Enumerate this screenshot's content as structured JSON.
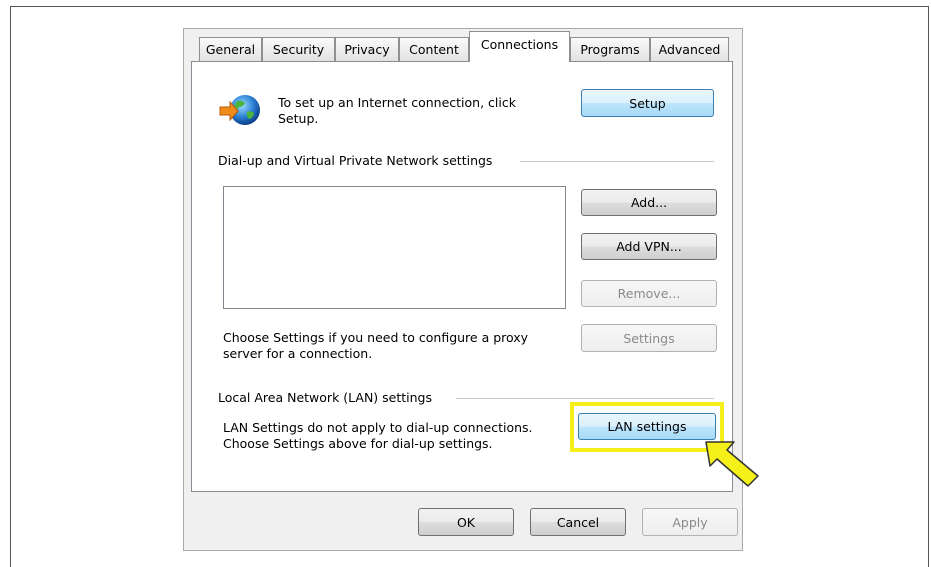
{
  "tabs": [
    {
      "label": "General",
      "active": false
    },
    {
      "label": "Security",
      "active": false
    },
    {
      "label": "Privacy",
      "active": false
    },
    {
      "label": "Content",
      "active": false
    },
    {
      "label": "Connections",
      "active": true
    },
    {
      "label": "Programs",
      "active": false
    },
    {
      "label": "Advanced",
      "active": false
    }
  ],
  "setup": {
    "text": "To set up an Internet connection, click Setup.",
    "button": "Setup",
    "icon": "globe-network-icon"
  },
  "dialup": {
    "group_label": "Dial-up and Virtual Private Network settings",
    "add_button": "Add...",
    "add_vpn_button": "Add VPN...",
    "remove_button": "Remove...",
    "proxy_text": "Choose Settings if you need to configure a proxy server for a connection.",
    "settings_button": "Settings"
  },
  "lan": {
    "group_label": "Local Area Network (LAN) settings",
    "text": "LAN Settings do not apply to dial-up connections. Choose Settings above for dial-up settings.",
    "button": "LAN settings"
  },
  "footer": {
    "ok": "OK",
    "cancel": "Cancel",
    "apply": "Apply"
  },
  "annotation": {
    "highlight_color": "#f5ef1a",
    "arrow_icon": "pointer-arrow-icon"
  }
}
